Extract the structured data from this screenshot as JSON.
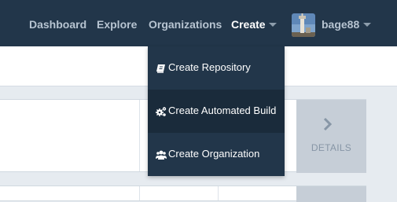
{
  "nav": {
    "dashboard": "Dashboard",
    "explore": "Explore",
    "organizations": "Organizations",
    "create": "Create",
    "username": "bage88"
  },
  "create_menu": {
    "items": [
      {
        "label": "Create Repository",
        "icon": "book-icon"
      },
      {
        "label": "Create Automated Build",
        "icon": "gears-icon"
      },
      {
        "label": "Create Organization",
        "icon": "users-icon"
      }
    ]
  },
  "repo_card": {
    "details_label": "DETAILS"
  },
  "colors": {
    "topbar": "#22364a",
    "page_background": "#e6ebf0",
    "details_panel": "#c6ced7",
    "menu_hover": "#1a2b3b"
  }
}
